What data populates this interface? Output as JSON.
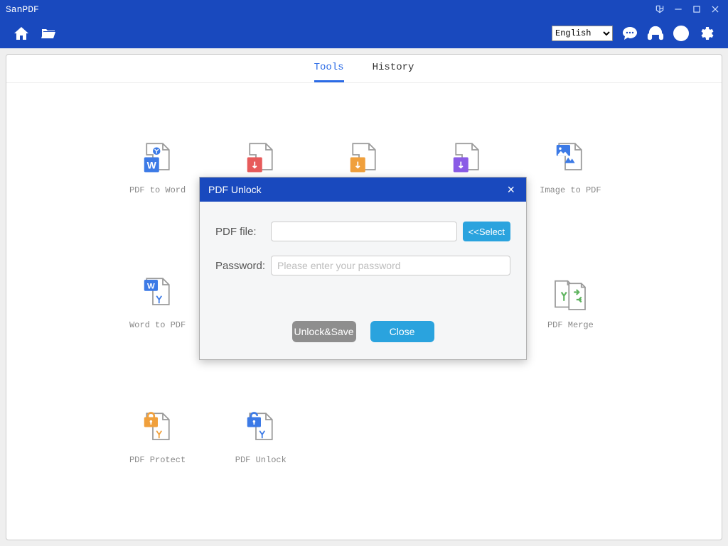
{
  "app": {
    "title": "SanPDF"
  },
  "language": {
    "selected": "English"
  },
  "tabs": {
    "tools": "Tools",
    "history": "History",
    "active": "tools"
  },
  "tools": {
    "pdf_to_word": "PDF to Word",
    "word_to_pdf": "Word to PDF",
    "image_to_pdf": "Image to PDF",
    "pdf_merge": "PDF Merge",
    "pdf_protect": "PDF Protect",
    "pdf_unlock": "PDF Unlock"
  },
  "dialog": {
    "title": "PDF Unlock",
    "file_label": "PDF file:",
    "file_value": "",
    "select_btn": "<<Select",
    "pwd_label": "Password:",
    "pwd_placeholder": "Please enter your password",
    "unlock_btn": "Unlock&Save",
    "close_btn": "Close"
  }
}
